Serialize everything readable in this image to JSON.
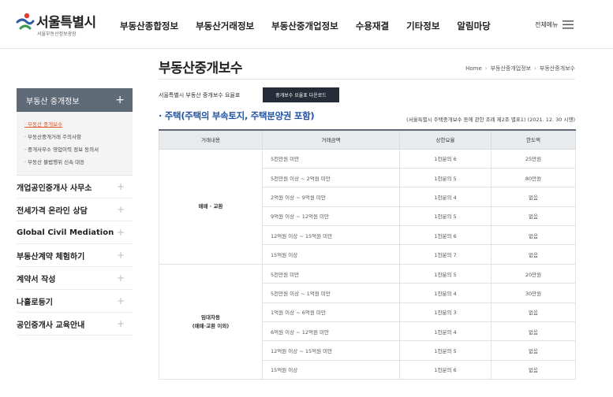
{
  "logo": {
    "title": "서울특별시",
    "subtitle": "서울부동산정보광장"
  },
  "gnb": [
    "부동산종합정보",
    "부동산거래정보",
    "부동산중개업정보",
    "수용재결",
    "기타정보",
    "알림마당"
  ],
  "all_menu_label": "전체메뉴",
  "page_title": "부동산중개보수",
  "breadcrumb": [
    "Home",
    "부동산중개업정보",
    "부동산중개보수"
  ],
  "sidebar": {
    "head": "부동산 중개정보",
    "sub_items": [
      {
        "label": "· 부동산 중개보수",
        "active": true
      },
      {
        "label": "· 부동산중개거래 주의사항",
        "active": false
      },
      {
        "label": "· 중개사무소 영업이력 정보 동의서",
        "active": false
      },
      {
        "label": "· 부동산 불법행위 신속 대응",
        "active": false
      }
    ],
    "menu": [
      "개업공인중개사 사무소",
      "전세가격 온라인 상담",
      "Global Civil Mediation",
      "부동산계약 체험하기",
      "계약서 작성",
      "나홀로등기",
      "공인중개사 교육안내"
    ]
  },
  "intro_text": "서울특별시 부동산 중개보수 요율표",
  "download_button": "중개보수 요율표 다운로드",
  "section_title": "· 주택(주택의 부속토지, 주택분양권 포함)",
  "section_note": "(서울특별시 주택중개보수 등에 관한 조례 제2조 별표1) (2021. 12. 30 시행)",
  "table": {
    "headers": [
      "거래내용",
      "거래금액",
      "상한요율",
      "한도액"
    ],
    "groups": [
      {
        "name_lines": [
          "매매 · 교환"
        ],
        "rows": [
          [
            "5천만원 미만",
            "1천분의 6",
            "25만원"
          ],
          [
            "5천만원 이상 ~ 2억원 미만",
            "1천분의 5",
            "80만원"
          ],
          [
            "2억원 이상 ~ 9억원 미만",
            "1천분의 4",
            "없음"
          ],
          [
            "9억원 이상 ~ 12억원 미만",
            "1천분의 5",
            "없음"
          ],
          [
            "12억원 이상 ~ 15억원 미만",
            "1천분의 6",
            "없음"
          ],
          [
            "15억원 이상",
            "1천분의 7",
            "없음"
          ]
        ]
      },
      {
        "name_lines": [
          "임대차등",
          "(매매·교환 이외)"
        ],
        "rows": [
          [
            "5천만원 미만",
            "1천분의 5",
            "20만원"
          ],
          [
            "5천만원 이상 ~ 1억원 미만",
            "1천분의 4",
            "30만원"
          ],
          [
            "1억원 이상 ~ 6억원 미만",
            "1천분의 3",
            "없음"
          ],
          [
            "6억원 이상 ~ 12억원 미만",
            "1천분의 4",
            "없음"
          ],
          [
            "12억원 이상 ~ 15억원 미만",
            "1천분의 5",
            "없음"
          ],
          [
            "15억원 이상",
            "1천분의 6",
            "없음"
          ]
        ]
      }
    ]
  },
  "colors": {
    "accent_blue": "#2155a3",
    "sidebar_head": "#5e6a76",
    "active_link": "#d9532b",
    "logo_red": "#e03c31",
    "logo_blue": "#2c5da6"
  }
}
